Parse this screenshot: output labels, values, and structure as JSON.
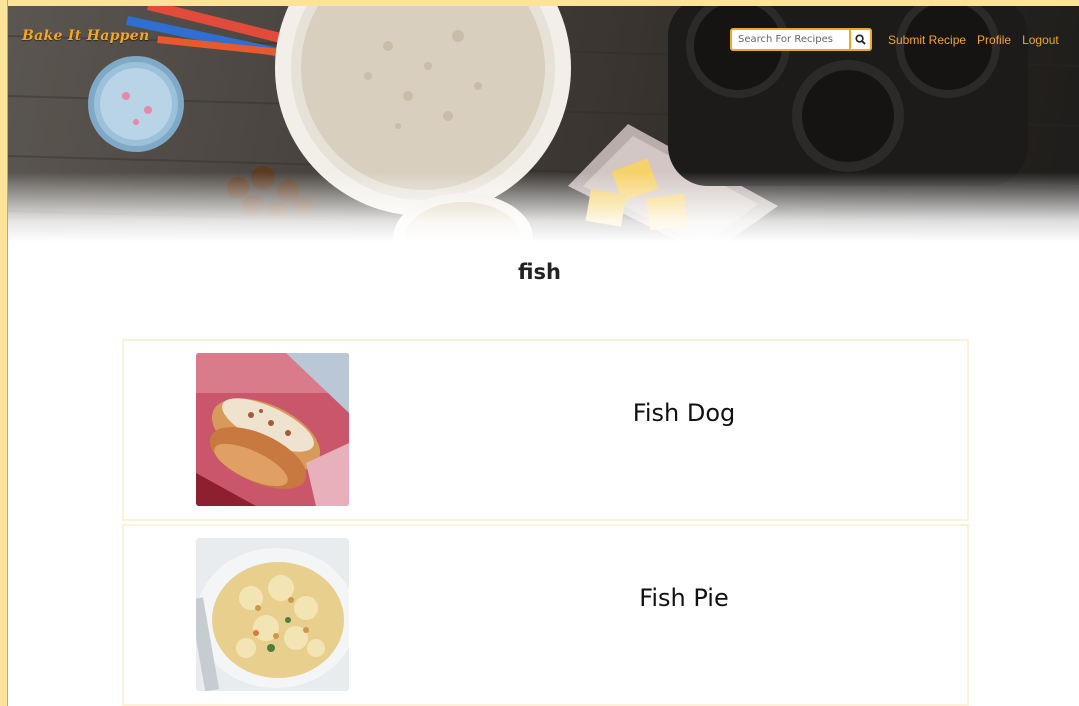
{
  "navbar": {
    "brand": "Bake It Happen",
    "search": {
      "placeholder": "Search For Recipes",
      "icon": "search-icon"
    },
    "links": [
      {
        "label": "Submit Recipe"
      },
      {
        "label": "Profile"
      },
      {
        "label": "Logout"
      }
    ]
  },
  "results": {
    "query_title": "fish",
    "items": [
      {
        "name": "Fish Dog",
        "image": "fish-dog-photo"
      },
      {
        "name": "Fish Pie",
        "image": "fish-pie-photo"
      }
    ]
  },
  "colors": {
    "accent": "#f5a623",
    "side_bar": "#fde39a",
    "card_border": "#fdf1da"
  }
}
